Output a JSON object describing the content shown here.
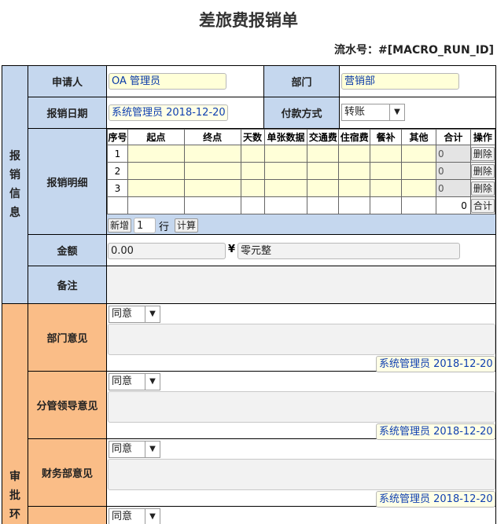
{
  "title": "差旅费报销单",
  "serial_label": "流水号：#[MACRO_RUN_ID]",
  "section_info": [
    "报",
    "销",
    "信",
    "息"
  ],
  "section_approval": [
    "审",
    "批",
    "环"
  ],
  "labels": {
    "applicant": "申请人",
    "department": "部门",
    "date": "报销日期",
    "payment": "付款方式",
    "details": "报销明细",
    "amount": "金额",
    "remark": "备注",
    "dept_opinion": "部门意见",
    "leader_opinion": "分管领导意见",
    "finance_opinion": "财务部意见"
  },
  "fields": {
    "applicant_value": "OA 管理员",
    "department_value": "营销部",
    "date_value": "系统管理员 2018-12-20",
    "payment_value": "转账",
    "amount_value": "0.00",
    "currency_symbol": "¥",
    "amount_words": "零元整"
  },
  "table": {
    "headers": [
      "序号",
      "起点",
      "终点",
      "天数",
      "单张数据",
      "交通费",
      "住宿费",
      "餐补",
      "其他",
      "合计",
      "操作"
    ],
    "rows": [
      {
        "no": "1",
        "total": "0",
        "action": "删除"
      },
      {
        "no": "2",
        "total": "0",
        "action": "删除"
      },
      {
        "no": "3",
        "total": "0",
        "action": "删除"
      }
    ],
    "sum_total": "0",
    "sum_action": "合计"
  },
  "row_controls": {
    "add_button": "新增",
    "row_count": "1",
    "row_unit": "行",
    "calc_button": "计算"
  },
  "opinions": {
    "dept_select": "同意",
    "dept_signature": "系统管理员 2018-12-20",
    "leader_select": "同意",
    "leader_signature": "系统管理员 2018-12-20",
    "finance_select": "同意",
    "finance_signature": "系统管理员 2018-12-20",
    "next_select": "同意"
  },
  "icons": {
    "dropdown": "chevron-down-icon"
  },
  "colors": {
    "info_section": "#c5d7ee",
    "approval_section": "#fabd87",
    "input_bg": "#ffffd8"
  }
}
